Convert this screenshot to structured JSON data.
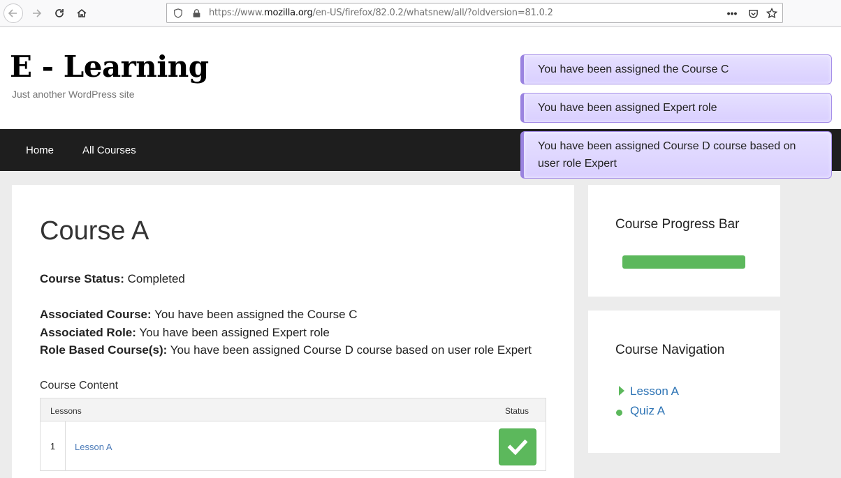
{
  "browser": {
    "url_prefix": "https://www.",
    "url_domain": "mozilla.org",
    "url_path": "/en-US/firefox/82.0.2/whatsnew/all/?oldversion=81.0.2"
  },
  "site": {
    "title": "E - Learning",
    "tagline": "Just another WordPress site"
  },
  "notices": [
    "You have been assigned the Course C",
    "You have been assigned Expert role",
    "You have been assigned Course D course based on user role Expert"
  ],
  "nav": {
    "home": "Home",
    "all_courses": "All Courses"
  },
  "course": {
    "title": "Course A",
    "status_label": "Course Status:",
    "status_value": "Completed",
    "assoc_course_label": "Associated Course:",
    "assoc_course_value": "You have been assigned the Course C",
    "assoc_role_label": "Associated Role:",
    "assoc_role_value": "You have been assigned Expert role",
    "role_based_label": "Role Based Course(s):",
    "role_based_value": "You have been assigned Course D course based on user role Expert",
    "content_label": "Course Content",
    "table": {
      "col_lessons": "Lessons",
      "col_status": "Status",
      "rows": [
        {
          "num": "1",
          "lesson": "Lesson A",
          "status": "completed"
        }
      ]
    }
  },
  "sidebar": {
    "progress_title": "Course Progress Bar",
    "progress_percent": 100,
    "nav_title": "Course Navigation",
    "nav_items": [
      {
        "label": "Lesson A",
        "marker": "triangle-icon"
      },
      {
        "label": "Quiz A",
        "marker": "dot-icon"
      }
    ]
  },
  "colors": {
    "success": "#5cb85c",
    "notice_bg": "#e0d8ff",
    "nav_bg": "#1e1e1e",
    "link": "#2e74b5"
  }
}
